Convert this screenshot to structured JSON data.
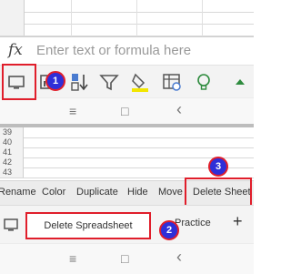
{
  "formula_bar": {
    "fx_label": "fx",
    "placeholder": "Enter text or formula here"
  },
  "toolbar": {
    "icons": [
      "keyboard-icon",
      "chart-icon",
      "sort-icon",
      "filter-icon",
      "fill-color-icon",
      "table-icon",
      "lightbulb-icon",
      "collapse-up-icon"
    ]
  },
  "bottom": {
    "row_numbers": [
      "39",
      "40",
      "41",
      "42",
      "43"
    ],
    "menu": {
      "rename": "Rename",
      "color": "Color",
      "duplicate": "Duplicate",
      "hide": "Hide",
      "move": "Move",
      "delete_sheet": "Delete Sheet"
    },
    "tabs": {
      "delete_spreadsheet": "Delete Spreadsheet",
      "practice": "Practice",
      "add": "+"
    }
  },
  "android_nav": {
    "recents": "≡",
    "home": "□",
    "back": "‹"
  },
  "annotations": {
    "badge1": "1",
    "badge2": "2",
    "badge3": "3"
  },
  "colors": {
    "annotation_red": "#e01e2b",
    "annotation_blue": "#2f2fd8"
  }
}
